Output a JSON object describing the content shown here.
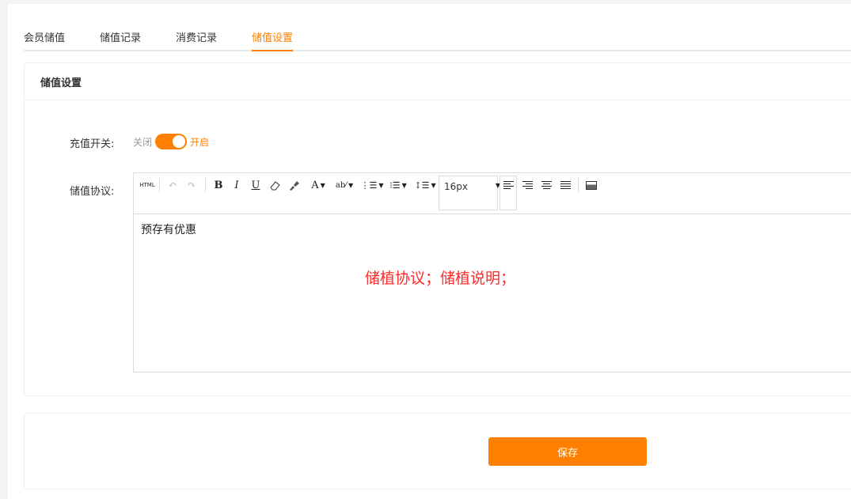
{
  "tabs": [
    {
      "label": "会员储值"
    },
    {
      "label": "储值记录"
    },
    {
      "label": "消费记录"
    },
    {
      "label": "储值设置"
    }
  ],
  "panel": {
    "title": "储值设置",
    "switch_label": "充值开关:",
    "switch_off": "关闭",
    "switch_on": "开启",
    "switch_state": "on",
    "agreement_label": "储值协议:"
  },
  "toolbar": {
    "html": "HTML",
    "bold": "B",
    "italic": "I",
    "underline": "U",
    "font_color": "A",
    "font_size": "16px"
  },
  "editor": {
    "content": "预存有优惠",
    "note": "储植协议；储植说明；"
  },
  "actions": {
    "save_label": "保存"
  },
  "colors": {
    "accent": "#ff8000",
    "note": "#ff2a2a"
  }
}
